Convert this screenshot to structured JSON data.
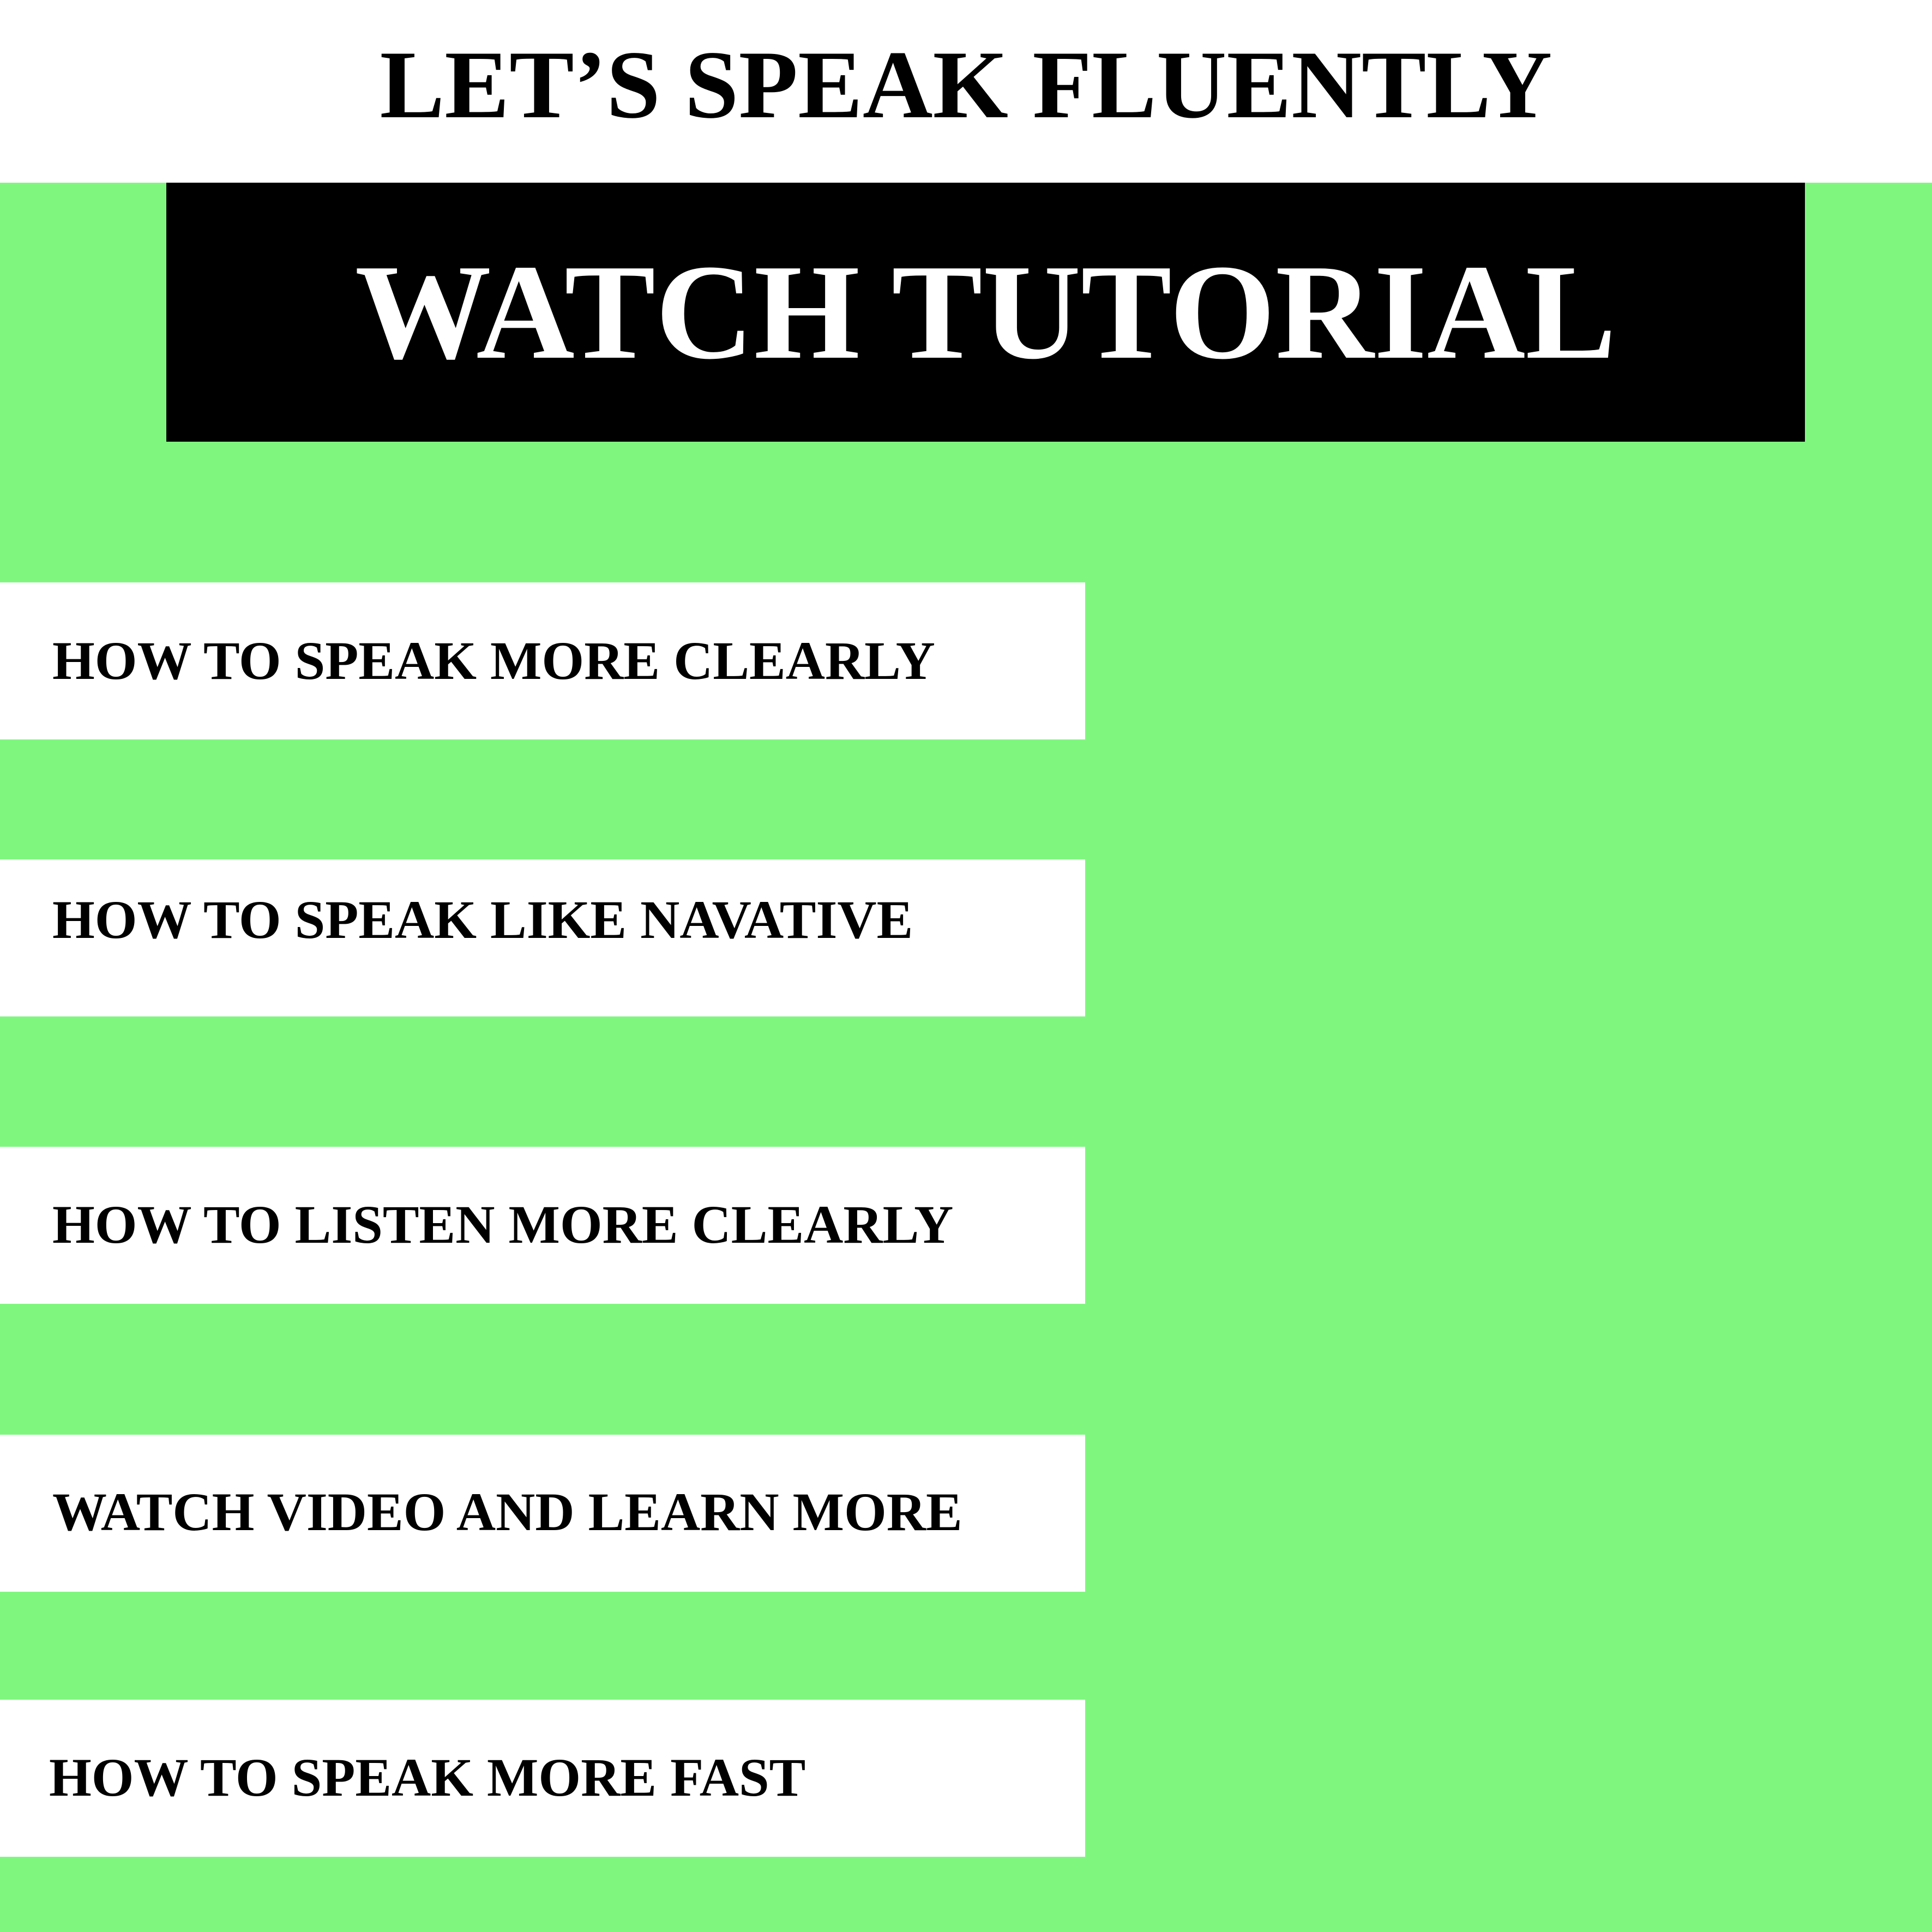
{
  "header": {
    "title": "LET’S SPEAK FLUENTLY"
  },
  "banner": {
    "label": "WATCH TUTORIAL"
  },
  "menu": {
    "items": [
      {
        "label": "HOW TO SPEAK MORE CLEARLY"
      },
      {
        "label": "HOW TO SPEAK LIKE NAVATIVE"
      },
      {
        "label": "HOW TO LISTEN MORE CLEARLY"
      },
      {
        "label": "WATCH VIDEO AND LEARN MORE"
      },
      {
        "label": "HOW TO SPEAK MORE FAST"
      }
    ]
  },
  "colors": {
    "background": "#7ff77f",
    "header_bg": "#ffffff",
    "banner_bg": "#000000",
    "banner_text": "#ffffff",
    "item_bg": "#ffffff",
    "text": "#000000"
  }
}
